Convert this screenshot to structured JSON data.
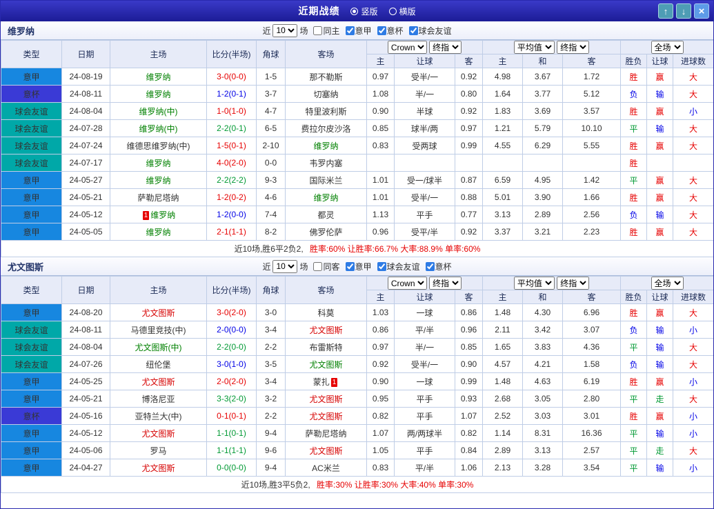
{
  "titlebar": {
    "title": "近期战绩",
    "radio_vertical": "竖版",
    "radio_horizontal": "横版",
    "up_icon": "↑",
    "down_icon": "↓",
    "close_icon": "×"
  },
  "controls": {
    "near_label": "近",
    "count_value": "10",
    "matches_label": "场",
    "book_value": "Crown",
    "final_value": "终指",
    "avg_value": "平均值",
    "scope_value": "全场"
  },
  "columns": {
    "type": "类型",
    "date": "日期",
    "home": "主场",
    "score": "比分(半场)",
    "corner": "角球",
    "away": "客场",
    "ah_home": "主",
    "ah_line": "让球",
    "ah_away": "客",
    "eu_home": "主",
    "eu_draw": "和",
    "eu_away": "客",
    "result": "胜负",
    "handicap": "让球",
    "goals": "进球数"
  },
  "colors": {
    "win": "#E60000",
    "draw": "#009933",
    "loss": "#0000E6",
    "focal_green": "#008000",
    "focal_red": "#D60000",
    "default_text": "#333333"
  },
  "type_colors": {
    "意甲": "#1787E0",
    "意杯": "#3A3AD6",
    "球会友谊": "#00A8A8"
  },
  "sections": [
    {
      "team": "维罗纳",
      "filters": [
        {
          "label": "同主",
          "checked": false
        },
        {
          "label": "意甲",
          "checked": true
        },
        {
          "label": "意杯",
          "checked": true
        },
        {
          "label": "球会友谊",
          "checked": true
        }
      ],
      "rows": [
        {
          "type": "意甲",
          "date": "24-08-19",
          "home": "维罗纳",
          "home_color": "green",
          "home_card": "",
          "score": "3-0(0-0)",
          "corner": "1-5",
          "away": "那不勒斯",
          "away_color": "",
          "away_card": "",
          "ah": [
            "0.97",
            "受半/一",
            "0.92"
          ],
          "eu": [
            "4.98",
            "3.67",
            "1.72"
          ],
          "res": [
            "胜",
            "赢",
            "大"
          ]
        },
        {
          "type": "意杯",
          "date": "24-08-11",
          "home": "维罗纳",
          "home_color": "green",
          "home_card": "",
          "score": "1-2(0-1)",
          "corner": "3-7",
          "away": "切塞纳",
          "away_color": "",
          "away_card": "",
          "ah": [
            "1.08",
            "半/一",
            "0.80"
          ],
          "eu": [
            "1.64",
            "3.77",
            "5.12"
          ],
          "res": [
            "负",
            "输",
            "大"
          ]
        },
        {
          "type": "球会友谊",
          "date": "24-08-04",
          "home": "维罗纳(中)",
          "home_color": "green",
          "home_card": "",
          "score": "1-0(1-0)",
          "corner": "4-7",
          "away": "特里波利斯",
          "away_color": "",
          "away_card": "",
          "ah": [
            "0.90",
            "半球",
            "0.92"
          ],
          "eu": [
            "1.83",
            "3.69",
            "3.57"
          ],
          "res": [
            "胜",
            "赢",
            "小"
          ]
        },
        {
          "type": "球会友谊",
          "date": "24-07-28",
          "home": "维罗纳(中)",
          "home_color": "green",
          "home_card": "",
          "score": "2-2(0-1)",
          "corner": "6-5",
          "away": "费拉尔皮沙洛",
          "away_color": "",
          "away_card": "",
          "ah": [
            "0.85",
            "球半/两",
            "0.97"
          ],
          "eu": [
            "1.21",
            "5.79",
            "10.10"
          ],
          "res": [
            "平",
            "输",
            "大"
          ]
        },
        {
          "type": "球会友谊",
          "date": "24-07-24",
          "home": "维德思维罗纳(中)",
          "home_color": "",
          "home_card": "",
          "score": "1-5(0-1)",
          "corner": "2-10",
          "away": "维罗纳",
          "away_color": "green",
          "away_card": "",
          "ah": [
            "0.83",
            "受两球",
            "0.99"
          ],
          "eu": [
            "4.55",
            "6.29",
            "5.55"
          ],
          "res": [
            "胜",
            "赢",
            "大"
          ]
        },
        {
          "type": "球会友谊",
          "date": "24-07-17",
          "home": "维罗纳",
          "home_color": "green",
          "home_card": "",
          "score": "4-0(2-0)",
          "corner": "0-0",
          "away": "韦罗内塞",
          "away_color": "",
          "away_card": "",
          "ah": [
            "",
            "",
            ""
          ],
          "eu": [
            "",
            "",
            ""
          ],
          "res": [
            "胜",
            "",
            ""
          ]
        },
        {
          "type": "意甲",
          "date": "24-05-27",
          "home": "维罗纳",
          "home_color": "green",
          "home_card": "",
          "score": "2-2(2-2)",
          "corner": "9-3",
          "away": "国际米兰",
          "away_color": "",
          "away_card": "",
          "ah": [
            "1.01",
            "受一/球半",
            "0.87"
          ],
          "eu": [
            "6.59",
            "4.95",
            "1.42"
          ],
          "res": [
            "平",
            "赢",
            "大"
          ]
        },
        {
          "type": "意甲",
          "date": "24-05-21",
          "home": "萨勒尼塔纳",
          "home_color": "",
          "home_card": "",
          "score": "1-2(0-2)",
          "corner": "4-6",
          "away": "维罗纳",
          "away_color": "green",
          "away_card": "",
          "ah": [
            "1.01",
            "受半/一",
            "0.88"
          ],
          "eu": [
            "5.01",
            "3.90",
            "1.66"
          ],
          "res": [
            "胜",
            "赢",
            "大"
          ]
        },
        {
          "type": "意甲",
          "date": "24-05-12",
          "home": "维罗纳",
          "home_color": "green",
          "home_card": "1",
          "score": "1-2(0-0)",
          "corner": "7-4",
          "away": "都灵",
          "away_color": "",
          "away_card": "",
          "ah": [
            "1.13",
            "平手",
            "0.77"
          ],
          "eu": [
            "3.13",
            "2.89",
            "2.56"
          ],
          "res": [
            "负",
            "输",
            "大"
          ]
        },
        {
          "type": "意甲",
          "date": "24-05-05",
          "home": "维罗纳",
          "home_color": "green",
          "home_card": "",
          "score": "2-1(1-1)",
          "corner": "8-2",
          "away": "佛罗伦萨",
          "away_color": "",
          "away_card": "",
          "ah": [
            "0.96",
            "受平/半",
            "0.92"
          ],
          "eu": [
            "3.37",
            "3.21",
            "2.23"
          ],
          "res": [
            "胜",
            "赢",
            "大"
          ]
        }
      ],
      "summary": {
        "lead": "近10场,胜6平2负2,",
        "stats": "胜率:60% 让胜率:66.7% 大率:88.9% 单率:60%"
      }
    },
    {
      "team": "尤文图斯",
      "filters": [
        {
          "label": "同客",
          "checked": false
        },
        {
          "label": "意甲",
          "checked": true
        },
        {
          "label": "球会友谊",
          "checked": true
        },
        {
          "label": "意杯",
          "checked": true
        }
      ],
      "rows": [
        {
          "type": "意甲",
          "date": "24-08-20",
          "home": "尤文图斯",
          "home_color": "red",
          "home_card": "",
          "score": "3-0(2-0)",
          "corner": "3-0",
          "away": "科莫",
          "away_color": "",
          "away_card": "",
          "ah": [
            "1.03",
            "一球",
            "0.86"
          ],
          "eu": [
            "1.48",
            "4.30",
            "6.96"
          ],
          "res": [
            "胜",
            "赢",
            "大"
          ]
        },
        {
          "type": "球会友谊",
          "date": "24-08-11",
          "home": "马德里竞技(中)",
          "home_color": "",
          "home_card": "",
          "score": "2-0(0-0)",
          "corner": "3-4",
          "away": "尤文图斯",
          "away_color": "red",
          "away_card": "",
          "ah": [
            "0.86",
            "平/半",
            "0.96"
          ],
          "eu": [
            "2.11",
            "3.42",
            "3.07"
          ],
          "res": [
            "负",
            "输",
            "小"
          ]
        },
        {
          "type": "球会友谊",
          "date": "24-08-04",
          "home": "尤文图斯(中)",
          "home_color": "green",
          "home_card": "",
          "score": "2-2(0-0)",
          "corner": "2-2",
          "away": "布雷斯特",
          "away_color": "",
          "away_card": "",
          "ah": [
            "0.97",
            "半/一",
            "0.85"
          ],
          "eu": [
            "1.65",
            "3.83",
            "4.36"
          ],
          "res": [
            "平",
            "输",
            "大"
          ]
        },
        {
          "type": "球会友谊",
          "date": "24-07-26",
          "home": "纽伦堡",
          "home_color": "",
          "home_card": "",
          "score": "3-0(1-0)",
          "corner": "3-5",
          "away": "尤文图斯",
          "away_color": "green",
          "away_card": "",
          "ah": [
            "0.92",
            "受半/一",
            "0.90"
          ],
          "eu": [
            "4.57",
            "4.21",
            "1.58"
          ],
          "res": [
            "负",
            "输",
            "大"
          ]
        },
        {
          "type": "意甲",
          "date": "24-05-25",
          "home": "尤文图斯",
          "home_color": "red",
          "home_card": "",
          "score": "2-0(2-0)",
          "corner": "3-4",
          "away": "蒙扎",
          "away_color": "",
          "away_card": "1",
          "ah": [
            "0.90",
            "一球",
            "0.99"
          ],
          "eu": [
            "1.48",
            "4.63",
            "6.19"
          ],
          "res": [
            "胜",
            "赢",
            "小"
          ]
        },
        {
          "type": "意甲",
          "date": "24-05-21",
          "home": "博洛尼亚",
          "home_color": "",
          "home_card": "",
          "score": "3-3(2-0)",
          "corner": "3-2",
          "away": "尤文图斯",
          "away_color": "red",
          "away_card": "",
          "ah": [
            "0.95",
            "平手",
            "0.93"
          ],
          "eu": [
            "2.68",
            "3.05",
            "2.80"
          ],
          "res": [
            "平",
            "走",
            "大"
          ]
        },
        {
          "type": "意杯",
          "date": "24-05-16",
          "home": "亚特兰大(中)",
          "home_color": "",
          "home_card": "",
          "score": "0-1(0-1)",
          "corner": "2-2",
          "away": "尤文图斯",
          "away_color": "red",
          "away_card": "",
          "ah": [
            "0.82",
            "平手",
            "1.07"
          ],
          "eu": [
            "2.52",
            "3.03",
            "3.01"
          ],
          "res": [
            "胜",
            "赢",
            "小"
          ]
        },
        {
          "type": "意甲",
          "date": "24-05-12",
          "home": "尤文图斯",
          "home_color": "red",
          "home_card": "",
          "score": "1-1(0-1)",
          "corner": "9-4",
          "away": "萨勒尼塔纳",
          "away_color": "",
          "away_card": "",
          "ah": [
            "1.07",
            "两/两球半",
            "0.82"
          ],
          "eu": [
            "1.14",
            "8.31",
            "16.36"
          ],
          "res": [
            "平",
            "输",
            "小"
          ]
        },
        {
          "type": "意甲",
          "date": "24-05-06",
          "home": "罗马",
          "home_color": "",
          "home_card": "",
          "score": "1-1(1-1)",
          "corner": "9-6",
          "away": "尤文图斯",
          "away_color": "red",
          "away_card": "",
          "ah": [
            "1.05",
            "平手",
            "0.84"
          ],
          "eu": [
            "2.89",
            "3.13",
            "2.57"
          ],
          "res": [
            "平",
            "走",
            "大"
          ]
        },
        {
          "type": "意甲",
          "date": "24-04-27",
          "home": "尤文图斯",
          "home_color": "red",
          "home_card": "",
          "score": "0-0(0-0)",
          "corner": "9-4",
          "away": "AC米兰",
          "away_color": "",
          "away_card": "",
          "ah": [
            "0.83",
            "平/半",
            "1.06"
          ],
          "eu": [
            "2.13",
            "3.28",
            "3.54"
          ],
          "res": [
            "平",
            "输",
            "小"
          ]
        }
      ],
      "summary": {
        "lead": "近10场,胜3平5负2,",
        "stats": "胜率:30% 让胜率:30% 大率:40% 单率:30%"
      }
    }
  ]
}
